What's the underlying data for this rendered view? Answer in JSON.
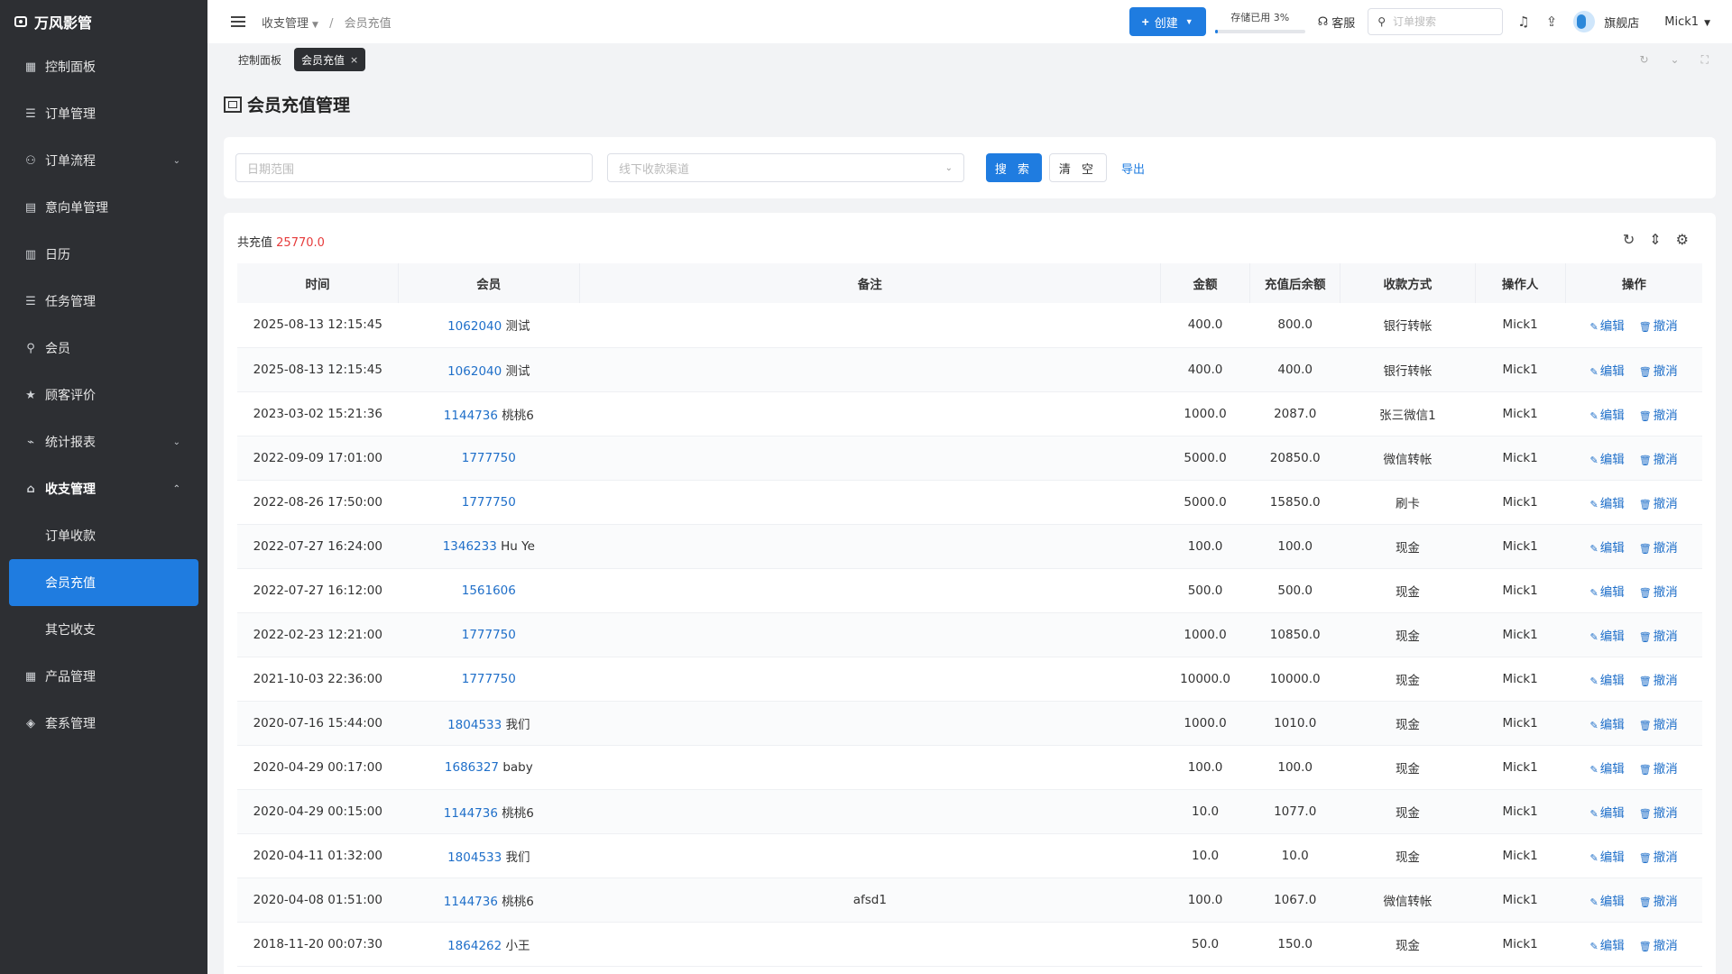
{
  "app": {
    "title": "万风影管"
  },
  "sidebar": {
    "items": [
      {
        "label": "控制面板",
        "icon": "dashboard-icon"
      },
      {
        "label": "订单管理",
        "icon": "list-icon"
      },
      {
        "label": "订单流程",
        "icon": "flow-icon",
        "expandable": true
      },
      {
        "label": "意向单管理",
        "icon": "clipboard-icon"
      },
      {
        "label": "日历",
        "icon": "calendar-icon"
      },
      {
        "label": "任务管理",
        "icon": "task-icon"
      },
      {
        "label": "会员",
        "icon": "user-icon"
      },
      {
        "label": "顾客评价",
        "icon": "star-icon"
      },
      {
        "label": "统计报表",
        "icon": "chart-icon",
        "expandable": true
      },
      {
        "label": "收支管理",
        "icon": "bank-icon",
        "expanded": true
      },
      {
        "label": "订单收款",
        "sub": true
      },
      {
        "label": "会员充值",
        "sub": true,
        "active": true
      },
      {
        "label": "其它收支",
        "sub": true
      },
      {
        "label": "产品管理",
        "icon": "grid-icon"
      },
      {
        "label": "套系管理",
        "icon": "box-icon"
      }
    ]
  },
  "header": {
    "breadcrumb": {
      "parent": "收支管理",
      "current": "会员充值"
    },
    "create_label": "创建",
    "storage_label": "存储已用 3%",
    "storage_percent": 3,
    "service_label": "客服",
    "search_placeholder": "订单搜索",
    "store_name": "旗舰店",
    "user_name": "Mick1"
  },
  "tabs": [
    {
      "label": "控制面板",
      "active": false
    },
    {
      "label": "会员充值",
      "active": true
    }
  ],
  "page": {
    "title": "会员充值管理"
  },
  "filters": {
    "date_placeholder": "日期范围",
    "channel_placeholder": "线下收款渠道",
    "search_label": "搜 索",
    "clear_label": "清 空",
    "export_label": "导出"
  },
  "summary": {
    "label": "共充值",
    "amount": "25770.0"
  },
  "table": {
    "columns": [
      "时间",
      "会员",
      "备注",
      "金额",
      "充值后余额",
      "收款方式",
      "操作人",
      "操作"
    ],
    "edit_label": "编辑",
    "revoke_label": "撤消",
    "rows": [
      {
        "time": "2025-08-13 12:15:45",
        "member_id": "1062040",
        "member_name": "测试",
        "note": "",
        "amount": "400.0",
        "balance": "800.0",
        "method": "银行转帐",
        "operator": "Mick1"
      },
      {
        "time": "2025-08-13 12:15:45",
        "member_id": "1062040",
        "member_name": "测试",
        "note": "",
        "amount": "400.0",
        "balance": "400.0",
        "method": "银行转帐",
        "operator": "Mick1"
      },
      {
        "time": "2023-03-02 15:21:36",
        "member_id": "1144736",
        "member_name": "桃桃6",
        "note": "",
        "amount": "1000.0",
        "balance": "2087.0",
        "method": "张三微信1",
        "operator": "Mick1"
      },
      {
        "time": "2022-09-09 17:01:00",
        "member_id": "1777750",
        "member_name": "",
        "note": "",
        "amount": "5000.0",
        "balance": "20850.0",
        "method": "微信转帐",
        "operator": "Mick1"
      },
      {
        "time": "2022-08-26 17:50:00",
        "member_id": "1777750",
        "member_name": "",
        "note": "",
        "amount": "5000.0",
        "balance": "15850.0",
        "method": "刷卡",
        "operator": "Mick1"
      },
      {
        "time": "2022-07-27 16:24:00",
        "member_id": "1346233",
        "member_name": "Hu Ye",
        "note": "",
        "amount": "100.0",
        "balance": "100.0",
        "method": "现金",
        "operator": "Mick1"
      },
      {
        "time": "2022-07-27 16:12:00",
        "member_id": "1561606",
        "member_name": "",
        "note": "",
        "amount": "500.0",
        "balance": "500.0",
        "method": "现金",
        "operator": "Mick1"
      },
      {
        "time": "2022-02-23 12:21:00",
        "member_id": "1777750",
        "member_name": "",
        "note": "",
        "amount": "1000.0",
        "balance": "10850.0",
        "method": "现金",
        "operator": "Mick1"
      },
      {
        "time": "2021-10-03 22:36:00",
        "member_id": "1777750",
        "member_name": "",
        "note": "",
        "amount": "10000.0",
        "balance": "10000.0",
        "method": "现金",
        "operator": "Mick1"
      },
      {
        "time": "2020-07-16 15:44:00",
        "member_id": "1804533",
        "member_name": "我们",
        "note": "",
        "amount": "1000.0",
        "balance": "1010.0",
        "method": "现金",
        "operator": "Mick1"
      },
      {
        "time": "2020-04-29 00:17:00",
        "member_id": "1686327",
        "member_name": "baby",
        "note": "",
        "amount": "100.0",
        "balance": "100.0",
        "method": "现金",
        "operator": "Mick1"
      },
      {
        "time": "2020-04-29 00:15:00",
        "member_id": "1144736",
        "member_name": "桃桃6",
        "note": "",
        "amount": "10.0",
        "balance": "1077.0",
        "method": "现金",
        "operator": "Mick1"
      },
      {
        "time": "2020-04-11 01:32:00",
        "member_id": "1804533",
        "member_name": "我们",
        "note": "",
        "amount": "10.0",
        "balance": "10.0",
        "method": "现金",
        "operator": "Mick1"
      },
      {
        "time": "2020-04-08 01:51:00",
        "member_id": "1144736",
        "member_name": "桃桃6",
        "note": "afsd1",
        "amount": "100.0",
        "balance": "1067.0",
        "method": "微信转帐",
        "operator": "Mick1"
      },
      {
        "time": "2018-11-20 00:07:30",
        "member_id": "1864262",
        "member_name": "小王",
        "note": "",
        "amount": "50.0",
        "balance": "150.0",
        "method": "现金",
        "operator": "Mick1"
      }
    ]
  }
}
